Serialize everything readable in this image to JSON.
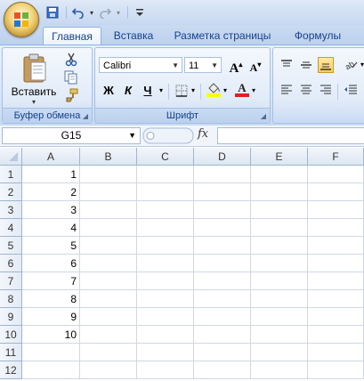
{
  "quick_access": {
    "icons": [
      "save-icon",
      "undo-icon",
      "redo-icon",
      "customize-icon"
    ]
  },
  "tabs": [
    {
      "label": "Главная",
      "active": true
    },
    {
      "label": "Вставка",
      "active": false
    },
    {
      "label": "Разметка страницы",
      "active": false
    },
    {
      "label": "Формулы",
      "active": false
    }
  ],
  "ribbon": {
    "clipboard": {
      "label": "Буфер обмена",
      "paste_label": "Вставить"
    },
    "font": {
      "label": "Шрифт",
      "font_name": "Calibri",
      "font_size": "11",
      "bold": "Ж",
      "italic": "К",
      "underline": "Ч"
    }
  },
  "formula_bar": {
    "name_box": "G15",
    "fx": "fx",
    "formula": ""
  },
  "sheet": {
    "columns": [
      "A",
      "B",
      "C",
      "D",
      "E",
      "F"
    ],
    "rows": [
      "1",
      "2",
      "3",
      "4",
      "5",
      "6",
      "7",
      "8",
      "9",
      "10",
      "11",
      "12"
    ],
    "col_a_values": [
      "1",
      "2",
      "3",
      "4",
      "5",
      "6",
      "7",
      "8",
      "9",
      "10",
      "",
      ""
    ]
  },
  "colors": {
    "accent": "#15428b",
    "ribbon_border": "#8db2e3",
    "font_color_bar": "#e02020",
    "highlight_bar": "#ffff00"
  }
}
